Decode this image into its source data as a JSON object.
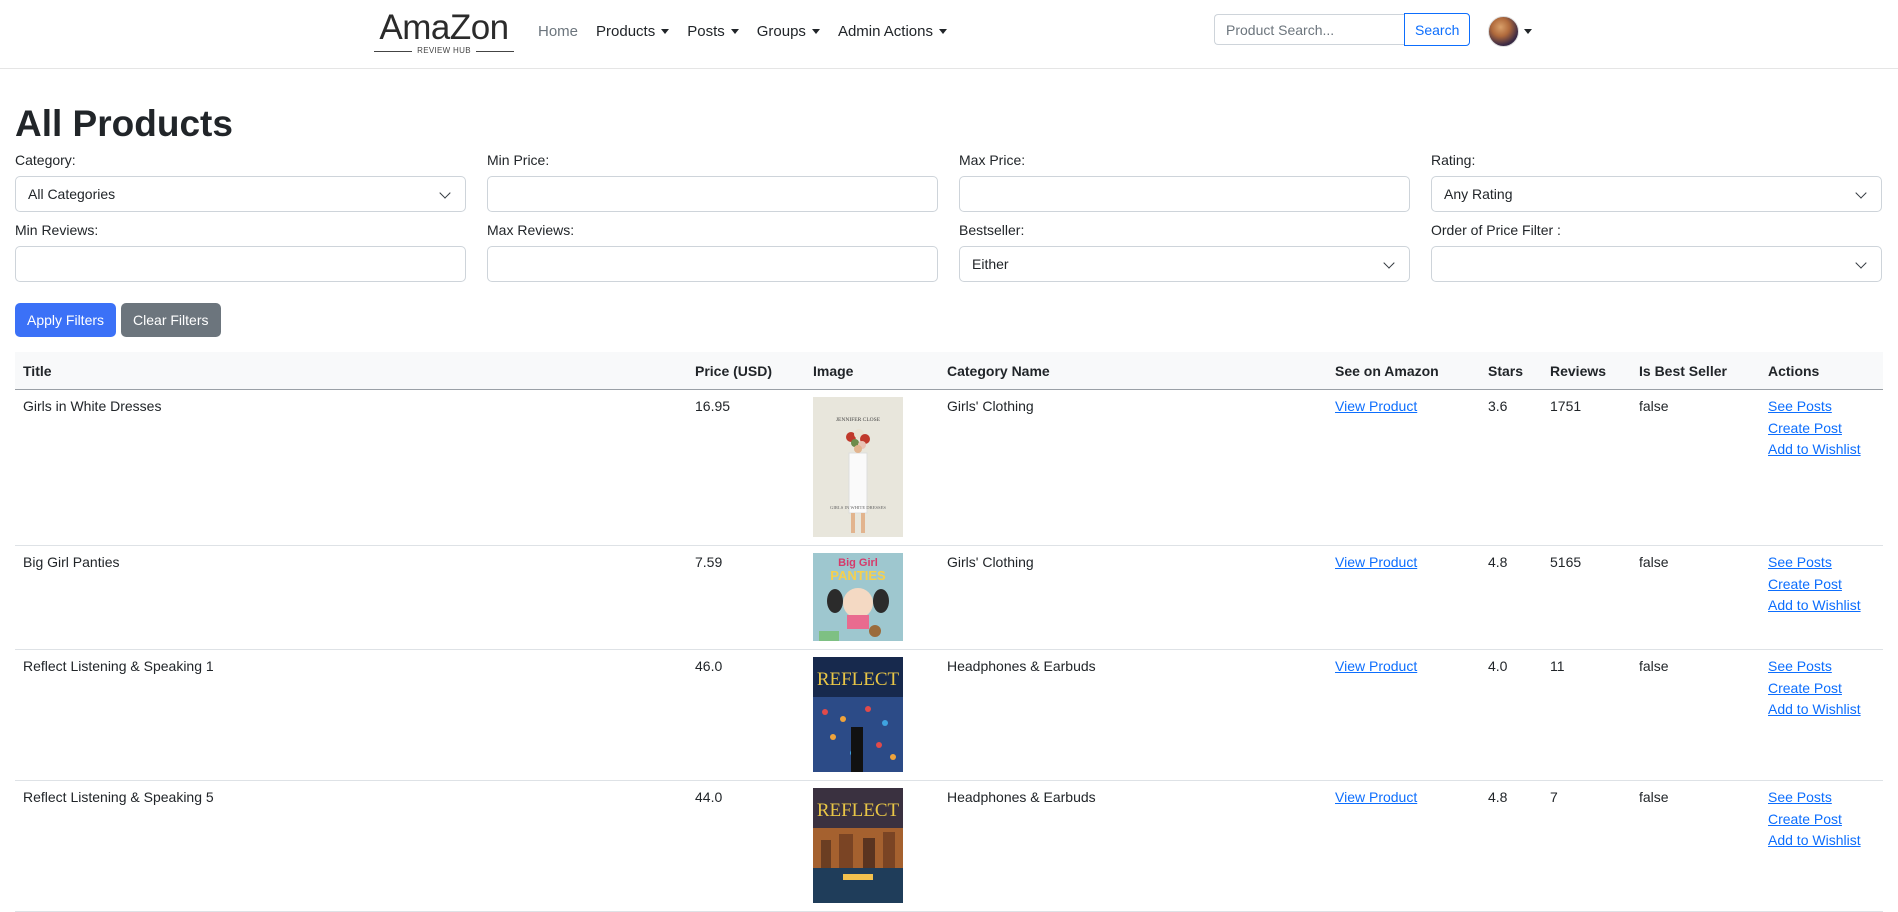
{
  "brand": {
    "name": "AmaZon",
    "sub": "REVIEW HUB"
  },
  "nav": {
    "home": "Home",
    "products": "Products",
    "posts": "Posts",
    "groups": "Groups",
    "admin": "Admin Actions"
  },
  "search": {
    "placeholder": "Product Search...",
    "button": "Search"
  },
  "page": {
    "title": "All Products"
  },
  "filters": {
    "category": {
      "label": "Category:",
      "value": "All Categories"
    },
    "min_price": {
      "label": "Min Price:",
      "value": ""
    },
    "max_price": {
      "label": "Max Price:",
      "value": ""
    },
    "rating": {
      "label": "Rating:",
      "value": "Any Rating"
    },
    "min_reviews": {
      "label": "Min Reviews:",
      "value": ""
    },
    "max_reviews": {
      "label": "Max Reviews:",
      "value": ""
    },
    "bestseller": {
      "label": "Bestseller:",
      "value": "Either"
    },
    "order_price": {
      "label": "Order of Price Filter :",
      "value": ""
    },
    "apply": "Apply Filters",
    "clear": "Clear Filters"
  },
  "table": {
    "headers": [
      "Title",
      "Price (USD)",
      "Image",
      "Category Name",
      "See on Amazon",
      "Stars",
      "Reviews",
      "Is Best Seller",
      "Actions"
    ],
    "rows": [
      {
        "title": "Girls in White Dresses",
        "price": "16.95",
        "category": "Girls' Clothing",
        "link": "View Product",
        "stars": "3.6",
        "reviews": "1751",
        "best": "false",
        "a1": "See Posts",
        "a2": "Create Post",
        "a3": "Add to Wishlist"
      },
      {
        "title": "Big Girl Panties",
        "price": "7.59",
        "category": "Girls' Clothing",
        "link": "View Product",
        "stars": "4.8",
        "reviews": "5165",
        "best": "false",
        "a1": "See Posts",
        "a2": "Create Post",
        "a3": "Add to Wishlist"
      },
      {
        "title": "Reflect Listening & Speaking 1",
        "price": "46.0",
        "category": "Headphones & Earbuds",
        "link": "View Product",
        "stars": "4.0",
        "reviews": "11",
        "best": "false",
        "a1": "See Posts",
        "a2": "Create Post",
        "a3": "Add to Wishlist"
      },
      {
        "title": "Reflect Listening & Speaking 5",
        "price": "44.0",
        "category": "Headphones & Earbuds",
        "link": "View Product",
        "stars": "4.8",
        "reviews": "7",
        "best": "false",
        "a1": "See Posts",
        "a2": "Create Post",
        "a3": "Add to Wishlist"
      }
    ]
  },
  "covers": {
    "row1_author": "JENNIFER CLOSE",
    "row1_title": "GIRLS IN WHITE DRESSES",
    "row2_title_a": "Big Girl",
    "row2_title_b": "PANTIES",
    "row3_title": "REFLECT",
    "row4_title": "REFLECT"
  }
}
